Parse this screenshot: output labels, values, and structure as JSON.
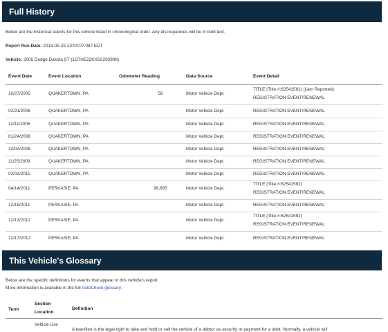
{
  "history": {
    "title": "Full History",
    "intro": "Below are the historical events for this vehicle listed in chronological order. Any discrepancies will be in bold text.",
    "run_date_label": "Report Run Date:",
    "run_date": "2013-05-25 13:04:07.087 EDT",
    "vehicle_label": "Vehicle:",
    "vehicle": "2005 Dodge Dakota ST (1D7HE22KX5S292808)",
    "columns": [
      "Event Date",
      "Event Location",
      "Odometer Reading",
      "Data Source",
      "Event Detail"
    ],
    "rows": [
      {
        "date": "10/27/2005",
        "location": "QUAKERTOWN, PA",
        "odometer": "56",
        "source": "Motor Vehicle Dept.",
        "detail1": "TITLE (Title #:62541592) (Lien Reported)",
        "detail2": "REGISTRATION EVENT/RENEWAL"
      },
      {
        "date": "02/21/2006",
        "location": "QUAKERTOWN, PA",
        "odometer": "",
        "source": "Motor Vehicle Dept.",
        "detail1": "REGISTRATION EVENT/RENEWAL",
        "detail2": ""
      },
      {
        "date": "12/11/2006",
        "location": "QUAKERTOWN, PA",
        "odometer": "",
        "source": "Motor Vehicle Dept.",
        "detail1": "REGISTRATION EVENT/RENEWAL",
        "detail2": ""
      },
      {
        "date": "01/24/2008",
        "location": "QUAKERTOWN, PA",
        "odometer": "",
        "source": "Motor Vehicle Dept.",
        "detail1": "REGISTRATION EVENT/RENEWAL",
        "detail2": ""
      },
      {
        "date": "12/04/2008",
        "location": "QUAKERTOWN, PA",
        "odometer": "",
        "source": "Motor Vehicle Dept.",
        "detail1": "REGISTRATION EVENT/RENEWAL",
        "detail2": ""
      },
      {
        "date": "11/25/2009",
        "location": "QUAKERTOWN, PA",
        "odometer": "",
        "source": "Motor Vehicle Dept.",
        "detail1": "REGISTRATION EVENT/RENEWAL",
        "detail2": ""
      },
      {
        "date": "02/03/2011",
        "location": "QUAKERTOWN, PA",
        "odometer": "",
        "source": "Motor Vehicle Dept.",
        "detail1": "REGISTRATION EVENT/RENEWAL",
        "detail2": ""
      },
      {
        "date": "04/14/2011",
        "location": "PERKASIE, PA",
        "odometer": "99,895",
        "source": "Motor Vehicle Dept.",
        "detail1": "TITLE (Title #:62541592)",
        "detail2": "REGISTRATION EVENT/RENEWAL"
      },
      {
        "date": "12/15/2011",
        "location": "PERKASIE, PA",
        "odometer": "",
        "source": "Motor Vehicle Dept.",
        "detail1": "REGISTRATION EVENT/RENEWAL",
        "detail2": ""
      },
      {
        "date": "12/13/2012",
        "location": "PERKASIE, PA",
        "odometer": "",
        "source": "Motor Vehicle Dept.",
        "detail1": "TITLE (Title #:62541592)",
        "detail2": "REGISTRATION EVENT/RENEWAL"
      },
      {
        "date": "12/17/2012",
        "location": "PERKASIE, PA",
        "odometer": "",
        "source": "Motor Vehicle Dept.",
        "detail1": "REGISTRATION EVENT/RENEWAL",
        "detail2": ""
      }
    ]
  },
  "glossary": {
    "title": "This Vehicle's Glossary",
    "intro1": "Below are the specific definitions for events that appear in this vehicle's report.",
    "intro2_prefix": "More information is available in the full ",
    "link_text": "AutoCheck glossary",
    "intro2_suffix": ".",
    "columns": {
      "term": "Term",
      "section_line1": "Section",
      "section_line2": "Location",
      "definition": "Definition"
    },
    "first_section": "Vehicle Use",
    "first_definition": "A loan/lien is the legal right to take and hold or sell the vehicle of a debtor as security or payment for a debt. Normally, a vehicle will"
  },
  "colors": {
    "banner": "#0f2a3f",
    "link": "#1f4fb5"
  }
}
